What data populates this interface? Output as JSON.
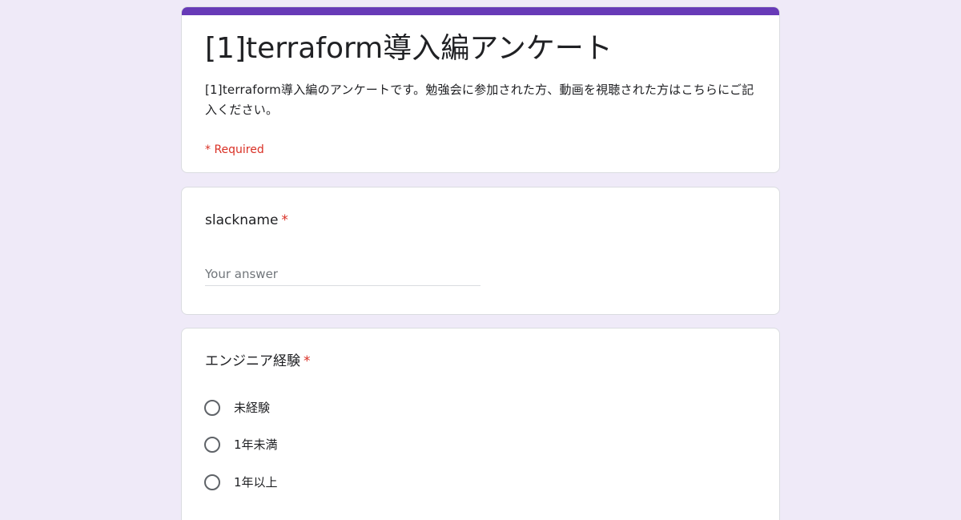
{
  "form": {
    "title": "[1]terraform導入編アンケート",
    "description": "[1]terraform導入編のアンケートです。勉強会に参加された方、動画を視聴された方はこちらにご記入ください。",
    "required_note": "* Required",
    "accent_color": "#673ab7",
    "background_color": "#efeaf8",
    "required_color": "#d93025"
  },
  "questions": [
    {
      "title": "slackname",
      "required_mark": "*",
      "type": "short_answer",
      "placeholder": "Your answer",
      "value": ""
    },
    {
      "title": "エンジニア経験",
      "required_mark": "*",
      "type": "radio",
      "options": [
        "未経験",
        "1年未満",
        "1年以上"
      ],
      "selected": null
    }
  ]
}
